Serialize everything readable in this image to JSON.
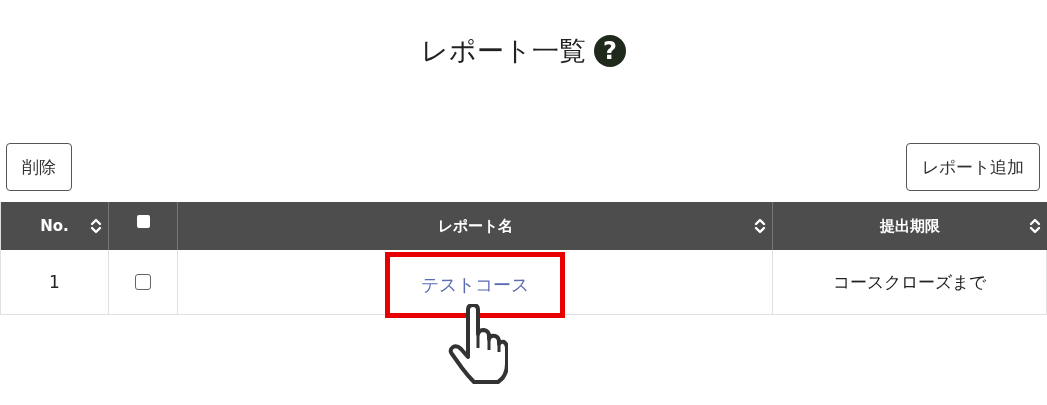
{
  "page": {
    "title": "レポート一覧",
    "help_icon": "?"
  },
  "toolbar": {
    "delete_button": "削除",
    "add_button": "レポート追加"
  },
  "table": {
    "columns": [
      {
        "kind": "text",
        "label": "No.",
        "sortable": true
      },
      {
        "kind": "checkbox",
        "checked": false,
        "sortable": false
      },
      {
        "kind": "text",
        "label": "レポート名",
        "sortable": true
      },
      {
        "kind": "text",
        "label": "提出期限",
        "sortable": true
      }
    ],
    "rows": [
      {
        "no": "1",
        "checked": false,
        "name": "テストコース",
        "deadline": "コースクローズまで",
        "highlighted": true
      }
    ]
  },
  "annotation": {
    "kind": "pointer"
  }
}
